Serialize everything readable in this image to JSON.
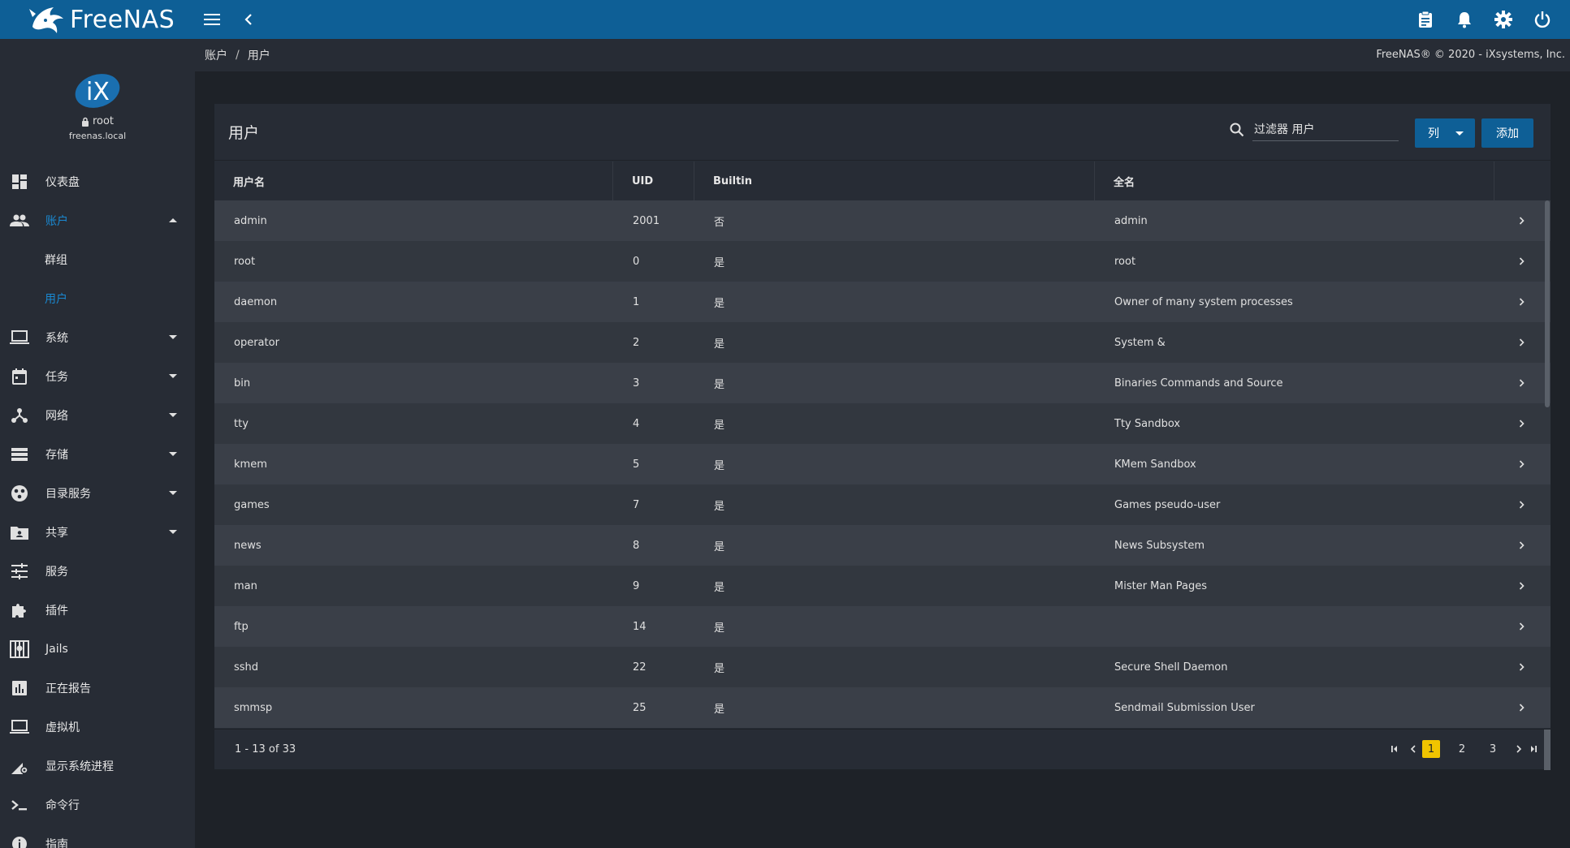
{
  "brand": {
    "name": "FreeNAS"
  },
  "topbar": {
    "icons": [
      "menu-icon",
      "chevron-left-icon",
      "clipboard-icon",
      "bell-icon",
      "gear-icon",
      "power-icon"
    ]
  },
  "user": {
    "name": "root",
    "host": "freenas.local"
  },
  "sidebar": {
    "items": [
      {
        "label": "仪表盘",
        "icon": "dashboard-icon"
      },
      {
        "label": "账户",
        "icon": "people-icon"
      },
      {
        "label": "群组"
      },
      {
        "label": "用户"
      },
      {
        "label": "系统",
        "icon": "laptop-icon"
      },
      {
        "label": "任务",
        "icon": "calendar-icon"
      },
      {
        "label": "网络",
        "icon": "network-icon"
      },
      {
        "label": "存储",
        "icon": "storage-icon"
      },
      {
        "label": "目录服务",
        "icon": "directory-icon"
      },
      {
        "label": "共享",
        "icon": "share-folder-icon"
      },
      {
        "label": "服务",
        "icon": "tune-icon"
      },
      {
        "label": "插件",
        "icon": "puzzle-icon"
      },
      {
        "label": "Jails",
        "icon": "jail-icon"
      },
      {
        "label": "正在报告",
        "icon": "report-icon"
      },
      {
        "label": "虚拟机",
        "icon": "computer-icon"
      },
      {
        "label": "显示系统进程",
        "icon": "process-icon"
      },
      {
        "label": "命令行",
        "icon": "terminal-icon"
      },
      {
        "label": "指南",
        "icon": "guide-icon"
      }
    ]
  },
  "breadcrumb": {
    "parent": "账户",
    "sep": "/",
    "current": "用户"
  },
  "copyright": "FreeNAS® © 2020 - iXsystems, Inc.",
  "card": {
    "title": "用户",
    "search_placeholder": "过滤器 用户",
    "columns_button": "列",
    "add_button": "添加"
  },
  "table": {
    "headers": [
      "用户名",
      "UID",
      "Builtin",
      "全名"
    ],
    "rows": [
      {
        "username": "admin",
        "uid": "2001",
        "builtin": "否",
        "fullname": "admin"
      },
      {
        "username": "root",
        "uid": "0",
        "builtin": "是",
        "fullname": "root"
      },
      {
        "username": "daemon",
        "uid": "1",
        "builtin": "是",
        "fullname": "Owner of many system processes"
      },
      {
        "username": "operator",
        "uid": "2",
        "builtin": "是",
        "fullname": "System &"
      },
      {
        "username": "bin",
        "uid": "3",
        "builtin": "是",
        "fullname": "Binaries Commands and Source"
      },
      {
        "username": "tty",
        "uid": "4",
        "builtin": "是",
        "fullname": "Tty Sandbox"
      },
      {
        "username": "kmem",
        "uid": "5",
        "builtin": "是",
        "fullname": "KMem Sandbox"
      },
      {
        "username": "games",
        "uid": "7",
        "builtin": "是",
        "fullname": "Games pseudo-user"
      },
      {
        "username": "news",
        "uid": "8",
        "builtin": "是",
        "fullname": "News Subsystem"
      },
      {
        "username": "man",
        "uid": "9",
        "builtin": "是",
        "fullname": "Mister Man Pages"
      },
      {
        "username": "ftp",
        "uid": "14",
        "builtin": "是",
        "fullname": ""
      },
      {
        "username": "sshd",
        "uid": "22",
        "builtin": "是",
        "fullname": "Secure Shell Daemon"
      },
      {
        "username": "smmsp",
        "uid": "25",
        "builtin": "是",
        "fullname": "Sendmail Submission User"
      }
    ]
  },
  "pagination": {
    "range": "1 - 13 of 33",
    "pages": [
      "1",
      "2",
      "3"
    ],
    "current": "1"
  },
  "colors": {
    "topbar": "#0e5f96",
    "sidebar": "#272c35",
    "accent": "#1a88d0",
    "page_active": "#f0c400"
  }
}
